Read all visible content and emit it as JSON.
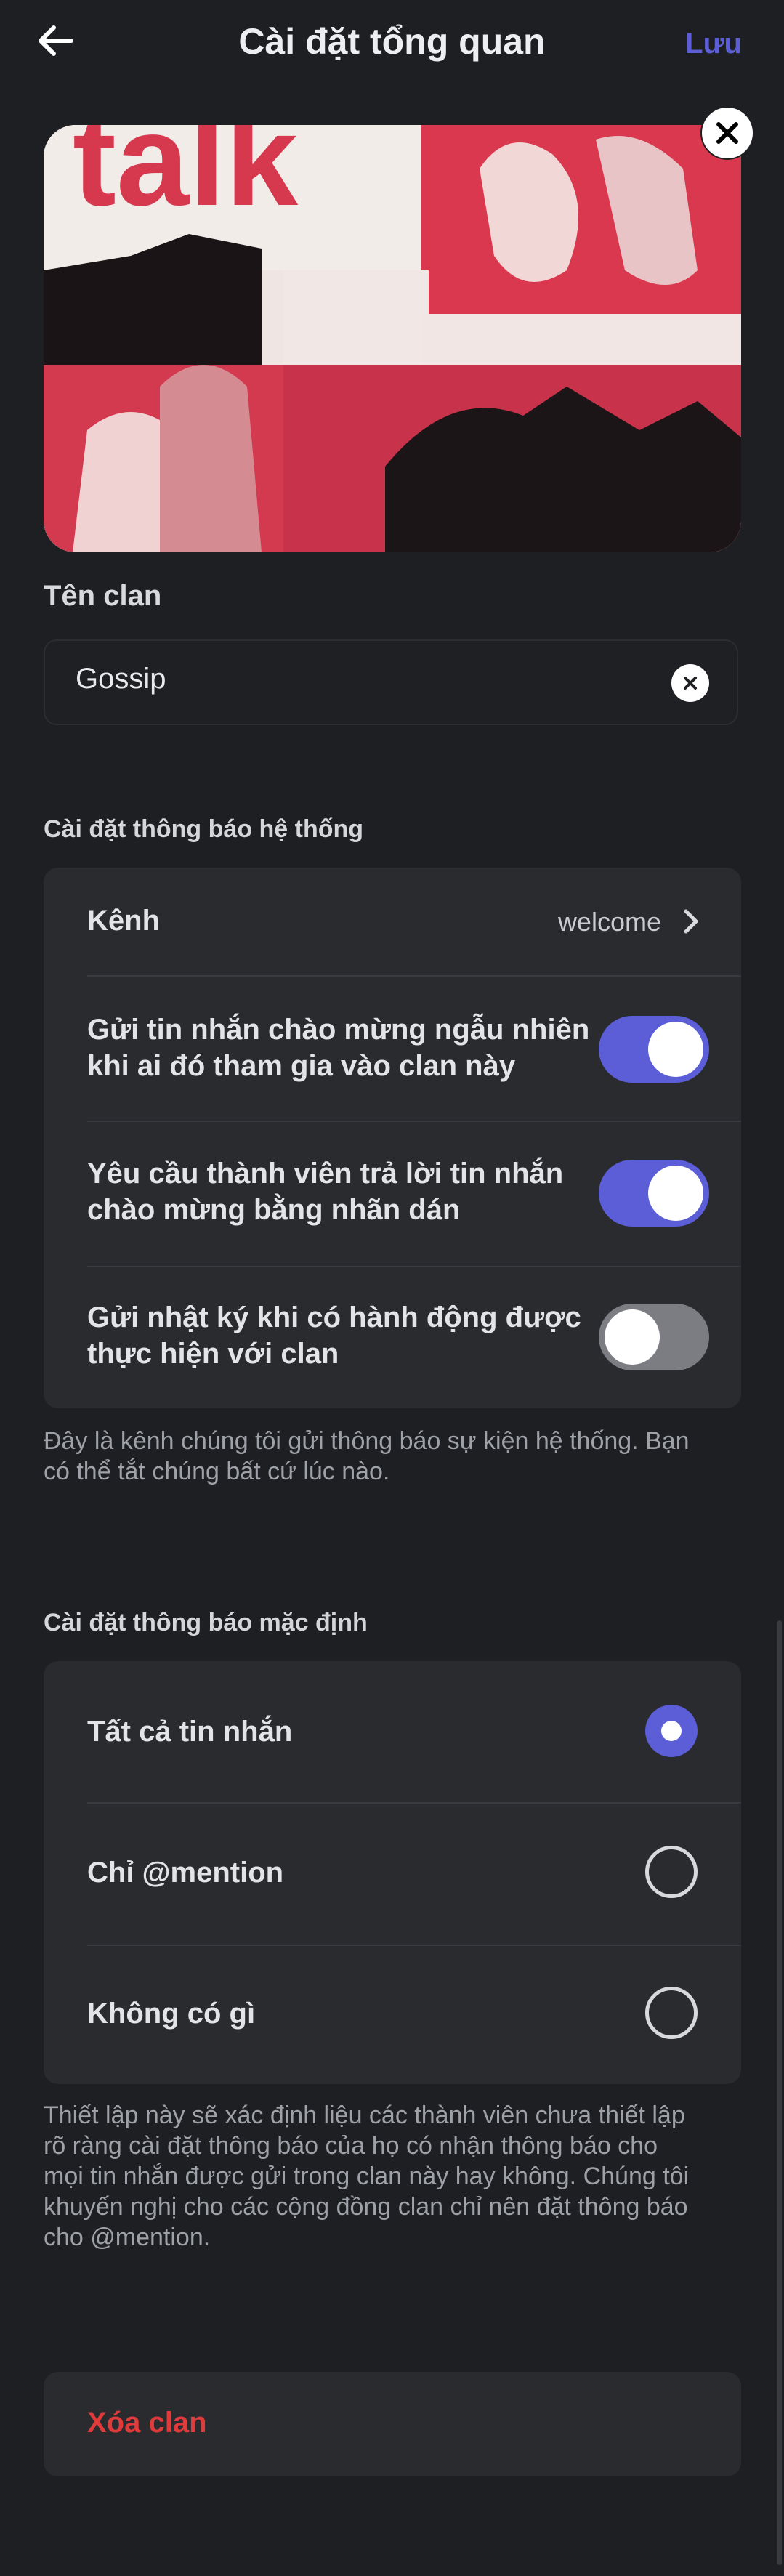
{
  "header": {
    "title": "Cài đặt tổng quan",
    "save_label": "Lưu"
  },
  "banner": {
    "art_text": "talk"
  },
  "clan_name": {
    "label": "Tên clan",
    "value": "Gossip"
  },
  "system_notifications": {
    "section_label": "Cài đặt thông báo hệ thống",
    "channel": {
      "label": "Kênh",
      "value": "welcome"
    },
    "toggles": [
      {
        "label_line1": "Gửi tin nhắn chào mừng ngẫu nhiên",
        "label_line2": "khi ai đó tham gia vào clan này",
        "on": true
      },
      {
        "label_line1": "Yêu cầu thành viên trả lời tin nhắn",
        "label_line2": "chào mừng bằng nhãn dán",
        "on": true
      },
      {
        "label_line1": "Gửi nhật ký khi có hành động được",
        "label_line2": "thực hiện với clan",
        "on": false
      }
    ],
    "description_line1": "Đây là kênh chúng tôi gửi thông báo sự kiện hệ thống. Bạn",
    "description_line2": "có thể tắt chúng bất cứ lúc nào."
  },
  "default_notifications": {
    "section_label": "Cài đặt thông báo mặc định",
    "options": [
      {
        "label": "Tất cả tin nhắn",
        "selected": true
      },
      {
        "label": "Chỉ @mention",
        "selected": false
      },
      {
        "label": "Không có gì",
        "selected": false
      }
    ],
    "description_lines": [
      "Thiết lập này sẽ xác định liệu các thành viên chưa thiết lập",
      "rõ ràng cài đặt thông báo của họ có nhận thông báo cho",
      "mọi tin nhắn được gửi trong clan này hay không. Chúng tôi",
      "khuyến nghị cho các cộng đồng clan chỉ nên đặt thông báo",
      "cho @mention."
    ]
  },
  "delete": {
    "label": "Xóa clan"
  },
  "colors": {
    "accent": "#5b5ed6",
    "danger": "#e03a3a",
    "background": "#1e1f22",
    "card": "#2a2b2f"
  }
}
